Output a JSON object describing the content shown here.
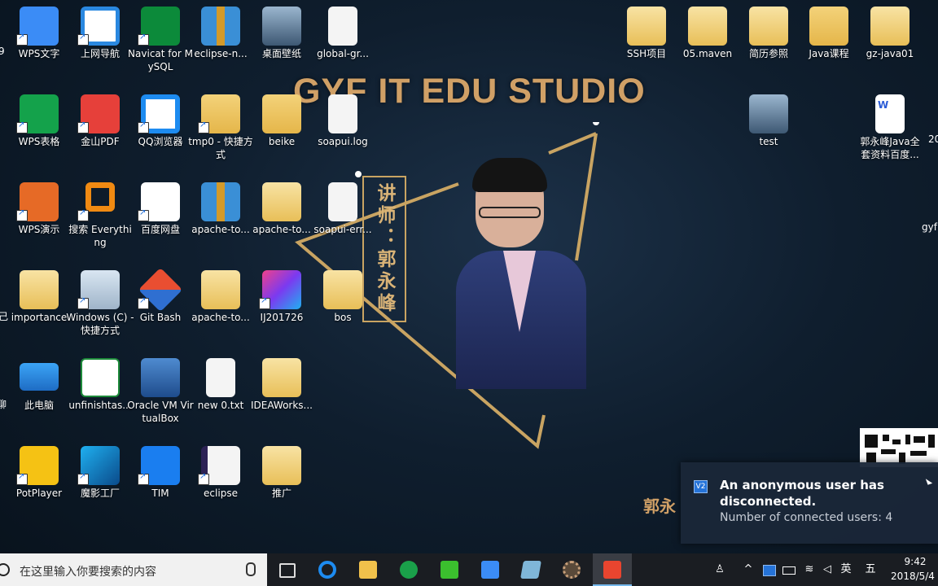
{
  "desktop": {
    "icons": [
      {
        "label": "WPS文字",
        "glyph": "wps-writer-icon"
      },
      {
        "label": "上网导航",
        "glyph": "ie-icon"
      },
      {
        "label": "Navicat for MySQL",
        "glyph": "navicat-icon"
      },
      {
        "label": "eclipse-n...",
        "glyph": "zip-icon"
      },
      {
        "label": "桌面壁纸",
        "glyph": "picture-folder-icon"
      },
      {
        "label": "global-gr...",
        "glyph": "file-icon"
      },
      {
        "label": "WPS表格",
        "glyph": "wps-spreadsheet-icon"
      },
      {
        "label": "金山PDF",
        "glyph": "pdf-icon"
      },
      {
        "label": "QQ浏览器",
        "glyph": "qq-browser-icon"
      },
      {
        "label": "tmp0 - 快捷方式",
        "glyph": "folder-icon"
      },
      {
        "label": "beike",
        "glyph": "folder-icon"
      },
      {
        "label": "soapui.log",
        "glyph": "file-icon"
      },
      {
        "label": "WPS演示",
        "glyph": "wps-presentation-icon"
      },
      {
        "label": "搜索 Everything",
        "glyph": "search-icon"
      },
      {
        "label": "百度网盘",
        "glyph": "baidu-netdisk-icon"
      },
      {
        "label": "apache-to...",
        "glyph": "zip-icon"
      },
      {
        "label": "apache-to...",
        "glyph": "folder-icon"
      },
      {
        "label": "soapui-err...",
        "glyph": "file-icon"
      },
      {
        "label": "importance",
        "glyph": "folder-icon"
      },
      {
        "label": "Windows (C) - 快捷方式",
        "glyph": "drive-icon"
      },
      {
        "label": "Git Bash",
        "glyph": "git-icon"
      },
      {
        "label": "apache-to...",
        "glyph": "folder-icon"
      },
      {
        "label": "IJ201726",
        "glyph": "intellij-icon"
      },
      {
        "label": "bos",
        "glyph": "folder-icon"
      },
      {
        "label": "此电脑",
        "glyph": "computer-icon"
      },
      {
        "label": "unfinishtas...",
        "glyph": "excel-icon"
      },
      {
        "label": "Oracle VM VirtualBox",
        "glyph": "virtualbox-icon"
      },
      {
        "label": "new 0.txt",
        "glyph": "file-icon"
      },
      {
        "label": "IDEAWorks...",
        "glyph": "folder-icon"
      },
      {
        "label": "PotPlayer",
        "glyph": "potplayer-icon"
      },
      {
        "label": "魔影工厂",
        "glyph": "movie-factory-icon"
      },
      {
        "label": "TIM",
        "glyph": "tim-icon"
      },
      {
        "label": "eclipse",
        "glyph": "eclipse-icon"
      },
      {
        "label": "推广",
        "glyph": "folder-icon"
      },
      {
        "label": "SSH项目",
        "glyph": "folder-icon"
      },
      {
        "label": "05.maven",
        "glyph": "folder-icon"
      },
      {
        "label": "简历参照",
        "glyph": "folder-icon"
      },
      {
        "label": "Java课程",
        "glyph": "folder-icon"
      },
      {
        "label": "gz-java01",
        "glyph": "folder-icon"
      },
      {
        "label": "test",
        "glyph": "picture-folder-icon"
      },
      {
        "label": "郭永峰Java全套资料百度...",
        "glyph": "word-icon"
      }
    ],
    "edge_fragments": [
      "9",
      "己",
      "聊",
      "20",
      "gyf"
    ]
  },
  "wallpaper": {
    "studio_title": "GYF IT EDU STUDIO",
    "lecturer": "讲师：郭永峰",
    "presenter_name": "郭永",
    "accent_color": "#d0a066"
  },
  "notification": {
    "app_icon": "vnc-icon",
    "title": "An anonymous user has disconnected.",
    "body": "Number of connected users: 4"
  },
  "taskbar": {
    "search_placeholder": "在这里输入你要搜索的内容",
    "apps": [
      "task-view-icon",
      "qq-browser-icon",
      "file-explorer-icon",
      "navicat-icon",
      "camtasia-icon",
      "wps-writer-icon",
      "virtualbox-icon",
      "settings-gear-icon",
      "camtasia-recorder-icon"
    ],
    "tray": {
      "input_method": "英",
      "ime_mode": "五",
      "time": "9:42",
      "date": "2018/5/4"
    }
  }
}
